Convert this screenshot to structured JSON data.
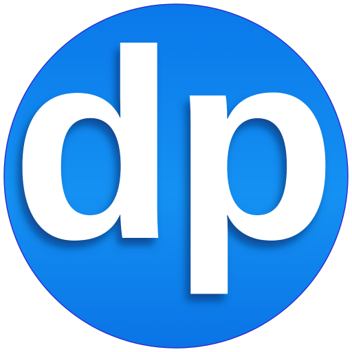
{
  "logo": {
    "text": "dp",
    "icon_name": "dp-logo-icon"
  },
  "colors": {
    "background": "#ffffff",
    "circle_top": "#0a78ea",
    "circle_mid": "#1491f2",
    "circle_bottom": "#0a74e6",
    "circle_border": "#2c2fd4",
    "text_fill": "#ffffff",
    "text_shadow": "#0b3f86"
  }
}
